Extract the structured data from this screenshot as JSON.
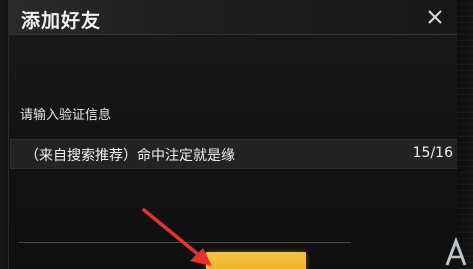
{
  "dialog": {
    "title": "添加好友"
  },
  "form": {
    "prompt_label": "请输入验证信息",
    "input_value": "（来自搜索推荐）命中注定就是缘",
    "char_count": "15/16"
  },
  "colors": {
    "accent": "#f4c542",
    "annotation_arrow": "#e8312a"
  },
  "icons": {
    "close": "close-icon",
    "annotation": "red-arrow-icon",
    "watermark": "site-logo-icon"
  }
}
